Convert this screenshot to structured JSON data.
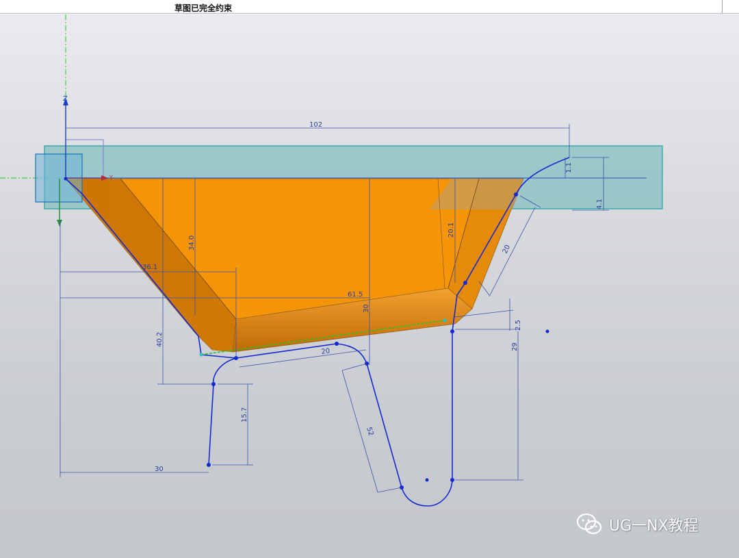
{
  "status": {
    "message": "草图已完全约束"
  },
  "axes": {
    "z_label": "Z",
    "y_label": "Y"
  },
  "dimensions": {
    "top_width": "102",
    "right_height_1": "1.1",
    "right_height_2": "4.1",
    "left_depth": "34.0",
    "inner_height": "20.1",
    "slant_right": "20",
    "left_horizontal": "36.1",
    "long_horizontal": "61.5",
    "middle_vertical": "30",
    "step_small": "2.5",
    "left_vertical": "40.2",
    "bottom_segment": "20",
    "right_vertical": "29",
    "leg_left_vertical": "15.7",
    "leg_slant": "52",
    "leg_bottom": "30"
  },
  "colors": {
    "model_fill": "#f29a1a",
    "plane_fill": "#8cc2c4",
    "sketch_line": "#1428d0",
    "dimension": "#3a52a8"
  },
  "watermark": {
    "text": "UG一NX教程",
    "icon": "wechat-icon"
  }
}
